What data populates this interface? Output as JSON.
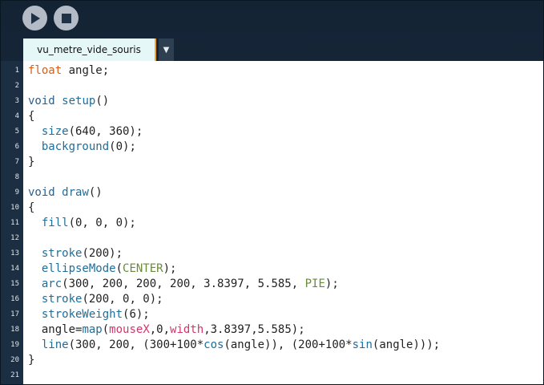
{
  "toolbar": {
    "run_icon": "play-icon",
    "stop_icon": "stop-icon"
  },
  "tab": {
    "label": "vu_metre_vide_souris",
    "menu_glyph": "▼"
  },
  "code": [
    [
      [
        "kw",
        "float"
      ],
      [
        "",
        " angle;"
      ]
    ],
    [],
    [
      [
        "dk",
        "void"
      ],
      [
        "",
        " "
      ],
      [
        "fn",
        "setup"
      ],
      [
        "",
        "()"
      ]
    ],
    [
      [
        "",
        "{"
      ]
    ],
    [
      [
        "",
        "  "
      ],
      [
        "fn",
        "size"
      ],
      [
        "",
        "(640, 360);"
      ]
    ],
    [
      [
        "",
        "  "
      ],
      [
        "fn",
        "background"
      ],
      [
        "",
        "(0);"
      ]
    ],
    [
      [
        "",
        "}"
      ]
    ],
    [],
    [
      [
        "dk",
        "void"
      ],
      [
        "",
        " "
      ],
      [
        "fn",
        "draw"
      ],
      [
        "",
        "()"
      ]
    ],
    [
      [
        "",
        "{"
      ]
    ],
    [
      [
        "",
        "  "
      ],
      [
        "fn",
        "fill"
      ],
      [
        "",
        "(0, 0, 0);"
      ]
    ],
    [],
    [
      [
        "",
        "  "
      ],
      [
        "fn",
        "stroke"
      ],
      [
        "",
        "(200);"
      ]
    ],
    [
      [
        "",
        "  "
      ],
      [
        "fn",
        "ellipseMode"
      ],
      [
        "",
        "("
      ],
      [
        "const",
        "CENTER"
      ],
      [
        "",
        ");"
      ]
    ],
    [
      [
        "",
        "  "
      ],
      [
        "fn",
        "arc"
      ],
      [
        "",
        "(300, 200, 200, 200, 3.8397, 5.585, "
      ],
      [
        "const",
        "PIE"
      ],
      [
        "",
        ");"
      ]
    ],
    [
      [
        "",
        "  "
      ],
      [
        "fn",
        "stroke"
      ],
      [
        "",
        "(200, 0, 0);"
      ]
    ],
    [
      [
        "",
        "  "
      ],
      [
        "fn",
        "strokeWeight"
      ],
      [
        "",
        "(6);"
      ]
    ],
    [
      [
        "",
        "  angle="
      ],
      [
        "fn",
        "map"
      ],
      [
        "",
        "("
      ],
      [
        "sys",
        "mouseX"
      ],
      [
        "",
        ",0,"
      ],
      [
        "sys",
        "width"
      ],
      [
        "",
        ",3.8397,5.585);"
      ]
    ],
    [
      [
        "",
        "  "
      ],
      [
        "fn",
        "line"
      ],
      [
        "",
        "(300, 200, (300+100*"
      ],
      [
        "fn",
        "cos"
      ],
      [
        "",
        "(angle)), (200+100*"
      ],
      [
        "fn",
        "sin"
      ],
      [
        "",
        "(angle)));"
      ]
    ],
    [
      [
        "",
        "}"
      ]
    ],
    []
  ],
  "line_numbers": [
    "1",
    "2",
    "3",
    "4",
    "5",
    "6",
    "7",
    "8",
    "9",
    "10",
    "11",
    "12",
    "13",
    "14",
    "15",
    "16",
    "17",
    "18",
    "19",
    "20",
    "21"
  ]
}
